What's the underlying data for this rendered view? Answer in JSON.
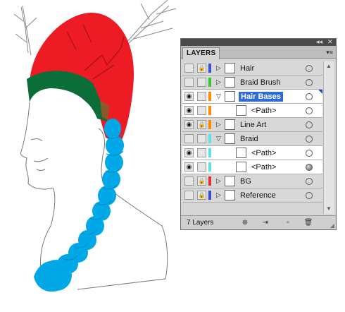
{
  "panel": {
    "collapse_icon": "◂◂",
    "close_icon": "✕",
    "tab_label": "LAYERS",
    "menu_icon": "▾≡",
    "layer_count": "7 Layers"
  },
  "layers": [
    {
      "name": "Hair",
      "visible": false,
      "locked": true,
      "color": "#3a4bd8",
      "expanded": false,
      "sub": false
    },
    {
      "name": "Braid Brush",
      "visible": false,
      "locked": false,
      "color": "#39c43a",
      "expanded": false,
      "sub": false
    },
    {
      "name": "Hair Bases",
      "visible": true,
      "locked": false,
      "color": "#ff8a00",
      "expanded": true,
      "sub": false,
      "selected": true
    },
    {
      "name": "<Path>",
      "visible": true,
      "locked": false,
      "color": "#ff8a00",
      "sub": true
    },
    {
      "name": "Line Art",
      "visible": true,
      "locked": true,
      "color": "#ff8a00",
      "expanded": false,
      "sub": false
    },
    {
      "name": "Braid",
      "visible": false,
      "locked": false,
      "color": "#5de0e6",
      "expanded": true,
      "sub": false
    },
    {
      "name": "<Path>",
      "visible": true,
      "locked": false,
      "color": "#5de0e6",
      "sub": true
    },
    {
      "name": "<Path>",
      "visible": true,
      "locked": false,
      "color": "#5de0e6",
      "sub": true,
      "target_filled": true
    },
    {
      "name": "BG",
      "visible": false,
      "locked": true,
      "color": "#e03030",
      "expanded": false,
      "sub": false
    },
    {
      "name": "Reference",
      "visible": false,
      "locked": true,
      "color": "#3a4bd8",
      "expanded": false,
      "sub": false
    }
  ],
  "icons": {
    "eye": "◉",
    "lock": "🔒",
    "collapsed_triangle": "▷",
    "expanded_triangle": "▽",
    "scroll_up": "▲",
    "scroll_down": "▼",
    "resize_grip": "◢"
  },
  "footer_icons": [
    "clipping-mask-icon",
    "new-sublayer-icon",
    "new-layer-icon",
    "delete-layer-icon"
  ],
  "colors": {
    "hair_red": "#ed1c24",
    "band_green": "#0b6e38",
    "braid_blue": "#00a8e8",
    "selection_blue": "#2f6bd4",
    "line_art": "#8a8a8a"
  }
}
